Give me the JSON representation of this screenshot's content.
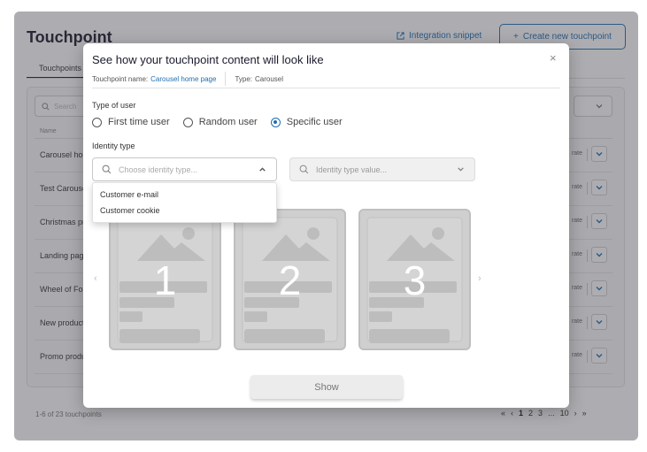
{
  "background": {
    "page_title": "Touchpoint",
    "integration_link": "Integration snippet",
    "create_button": "Create new touchpoint",
    "tab_label": "Touchpoints",
    "search_placeholder": "Search",
    "column_name": "Name",
    "rows": [
      {
        "name": "Carousel home",
        "action": "rate"
      },
      {
        "name": "Test Carousel",
        "action": "rate"
      },
      {
        "name": "Christmas pr",
        "action": "rate"
      },
      {
        "name": "Landing page",
        "action": "rate"
      },
      {
        "name": "Wheel of For",
        "action": "rate"
      },
      {
        "name": "New product",
        "action": "rate"
      },
      {
        "name": "Promo produ",
        "action": "rate"
      }
    ],
    "footer_count": "1-6 of 23 touchpoints",
    "pager": [
      "«",
      "‹",
      "1",
      "2",
      "3",
      "...",
      "10",
      "›",
      "»"
    ]
  },
  "modal": {
    "title": "See how your touchpoint content will look like",
    "close_icon": "×",
    "touchpoint_name_label": "Touchpoint name:",
    "touchpoint_name_value": "Carousel home page",
    "type_label": "Type:",
    "type_value": "Carousel",
    "user_type_label": "Type of user",
    "user_types": [
      {
        "label": "First time user",
        "checked": false
      },
      {
        "label": "Random user",
        "checked": false
      },
      {
        "label": "Specific user",
        "checked": true
      }
    ],
    "identity_type_label": "Identity type",
    "identity_type_placeholder": "Choose identity type...",
    "identity_value_placeholder": "Identity type value...",
    "identity_options": [
      "Customer e-mail",
      "Customer cookie"
    ],
    "cards": [
      "1",
      "2",
      "3"
    ],
    "prev_arrow": "‹",
    "next_arrow": "›",
    "show_button": "Show"
  },
  "colors": {
    "accent": "#1f6fb2",
    "text_dark": "#1a1a2e",
    "card_bg": "#cfcfcf"
  }
}
